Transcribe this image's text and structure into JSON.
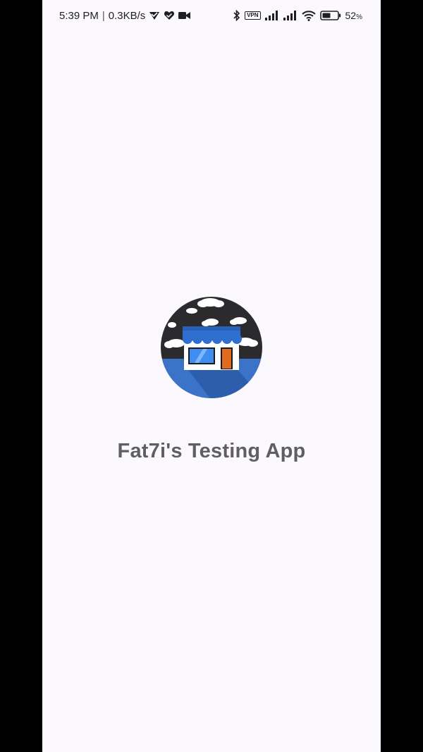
{
  "status_bar": {
    "time": "5:39 PM",
    "separator": "|",
    "network_speed": "0.3KB/s",
    "vpn_label": "VPN",
    "battery_level": "52",
    "battery_unit": "%"
  },
  "splash": {
    "app_title": "Fat7i's Testing App"
  },
  "colors": {
    "background": "#fbf9fd",
    "title_text": "#5f5f5f",
    "logo_sky": "#2b2b2d",
    "logo_ground": "#3a73c8",
    "awning": "#2f6fcf",
    "door": "#e06a1e"
  },
  "icons": {
    "logo": "store-logo-icon",
    "bluetooth": "bluetooth-icon",
    "signal": "signal-icon",
    "wifi": "wifi-icon",
    "battery": "battery-icon"
  }
}
